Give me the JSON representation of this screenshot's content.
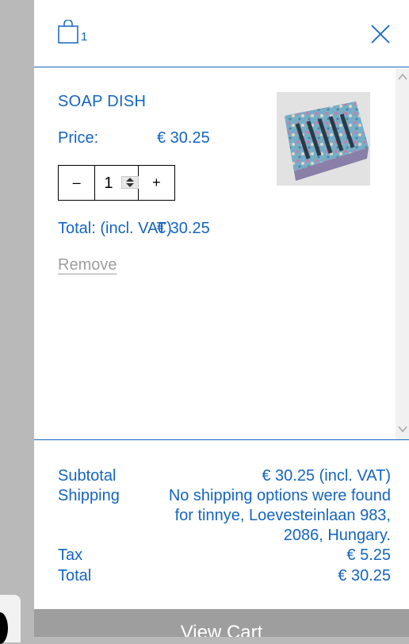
{
  "cart": {
    "item_count": "1",
    "colors": {
      "accent": "#1565c0",
      "muted": "#9e9e9e"
    }
  },
  "item": {
    "name": "SOAP DISH",
    "price_label": "Price:",
    "price_value": "€ 30.25",
    "quantity": "1",
    "minus_label": "–",
    "plus_label": "+",
    "total_label": "Total: (incl. VAT)",
    "total_value": "€ 30.25",
    "remove_label": "Remove"
  },
  "summary": {
    "subtotal_label": "Subtotal",
    "subtotal_value": "€ 30.25 (incl. VAT)",
    "shipping_label": "Shipping",
    "shipping_line1": "No shipping options were found",
    "shipping_line2": "for tinnye, Loevesteinlaan 983,",
    "shipping_line3": "2086, Hungary.",
    "tax_label": "Tax",
    "tax_value": "€ 5.25",
    "total_label": "Total",
    "total_value": "€ 30.25"
  },
  "actions": {
    "view_cart_label": "View Cart"
  },
  "icons": {
    "bag": "shopping-bag-icon",
    "close": "close-icon",
    "scroll_up": "chevron-up-icon",
    "scroll_down": "chevron-down-icon"
  }
}
